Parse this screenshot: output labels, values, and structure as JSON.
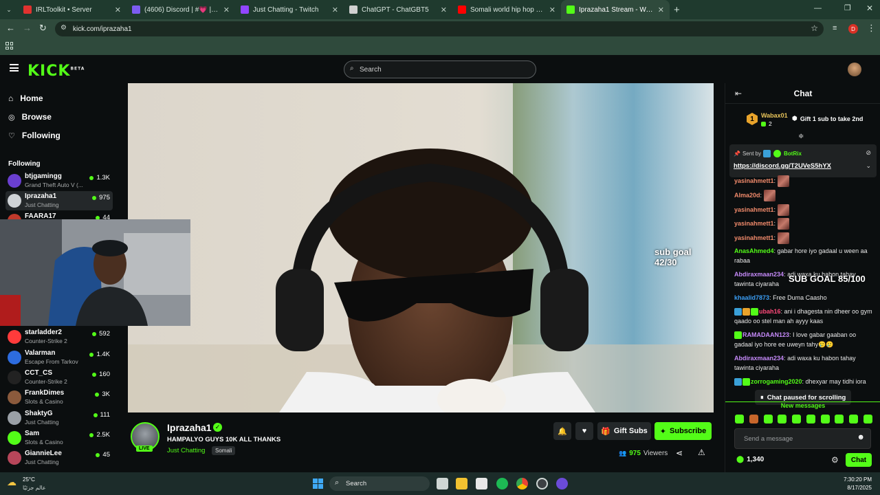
{
  "browser": {
    "tabs": [
      {
        "title": "IRLToolkit • Server",
        "color": "#e0322f"
      },
      {
        "title": "(4606) Discord | #💗 | STEAR",
        "color": "#7c5cf0"
      },
      {
        "title": "Just Chatting - Twitch",
        "color": "#9146ff"
      },
      {
        "title": "ChatGPT - ChatGBT5",
        "color": "#d0d0d0"
      },
      {
        "title": "Somali world hip hop Tonight",
        "color": "#ff0000"
      },
      {
        "title": "Iprazaha1 Stream - Watch Live",
        "color": "#53fc18"
      }
    ],
    "url": "kick.com/iprazaha1",
    "profile_letter": "D"
  },
  "header": {
    "logo": "KICK",
    "logo_sup": "BETA",
    "search_placeholder": "Search"
  },
  "sidebar": {
    "nav": [
      {
        "label": "Home"
      },
      {
        "label": "Browse"
      },
      {
        "label": "Following"
      }
    ],
    "following_title": "Following",
    "channels": [
      {
        "name": "btjgamingg",
        "game": "Grand Theft Auto V (...",
        "viewers": "1.3K",
        "color": "#6a3fd0"
      },
      {
        "name": "Iprazaha1",
        "game": "Just Chatting",
        "viewers": "975",
        "color": "#cfd3d6"
      },
      {
        "name": "FAARA17",
        "game": "",
        "viewers": "44",
        "color": "#c0392b"
      },
      {
        "name": "starladder2",
        "game": "Counter-Strike 2",
        "viewers": "592",
        "color": "#ff3b3b"
      },
      {
        "name": "Valarman",
        "game": "Escape From Tarkov",
        "viewers": "1.4K",
        "color": "#2d6cdf"
      },
      {
        "name": "CCT_CS",
        "game": "Counter-Strike 2",
        "viewers": "160",
        "color": "#222"
      },
      {
        "name": "FrankDimes",
        "game": "Slots & Casino",
        "viewers": "3K",
        "color": "#8b5a3c"
      },
      {
        "name": "ShaktyG",
        "game": "Just Chatting",
        "viewers": "111",
        "color": "#9aa0a6"
      },
      {
        "name": "Sam",
        "game": "Slots & Casino",
        "viewers": "2.5K",
        "color": "#53fc18"
      },
      {
        "name": "GiannieLee",
        "game": "Just Chatting",
        "viewers": "45",
        "color": "#b7465a"
      }
    ]
  },
  "video": {
    "overlay_sub_goal_small": "sub goal 42/30",
    "overlay_sub_goal_big": "SUB GOAL 85/100"
  },
  "channel": {
    "name": "Iprazaha1",
    "title": "HAMPALYO GUYS 10K ALL THANKS",
    "category": "Just Chatting",
    "tag": "Somali",
    "live_label": "LIVE",
    "gift_label": "Gift Subs",
    "subscribe_label": "Subscribe",
    "viewers": "975",
    "viewers_label": "Viewers"
  },
  "chat": {
    "title": "Chat",
    "leader": {
      "rank": "1",
      "name": "Wabax01",
      "count": "2",
      "action": "Gift 1 sub to take 2nd"
    },
    "pinned": {
      "sent_by_label": "Sent by",
      "sender": "BotRix",
      "link": "https://discord.gg/T2UVeS5hYX"
    },
    "messages": [
      {
        "user": "yasinahmett1",
        "text": "",
        "color": "#f08a6b",
        "emote": true
      },
      {
        "user": "Alma20d",
        "text": "",
        "color": "#f08a6b",
        "emote": true
      },
      {
        "user": "yasinahmett1",
        "text": "",
        "color": "#f08a6b",
        "emote": true
      },
      {
        "user": "yasinahmett1",
        "text": "",
        "color": "#f08a6b",
        "emote": true
      },
      {
        "user": "yasinahmett1",
        "text": "",
        "color": "#f08a6b",
        "emote": true
      },
      {
        "user": "AnasAhmed4",
        "text": "gabar hore iyo gadaal u ween aa rabaa",
        "color": "#53fc18",
        "emote": false
      },
      {
        "user": "Abdiraxmaan234",
        "text": "adi waxa ku habon tahay tawinta ciyaraha",
        "color": "#c58af9",
        "emote": false
      },
      {
        "user": "khaalid7873",
        "text": "Free Duma Caasho",
        "color": "#3b9ef5",
        "emote": false
      },
      {
        "user": "ubah16",
        "text": "ani i dhagesta nin dheer oo gym qaado oo stel man ah ayyy kaas",
        "color": "#ff4a7a",
        "emote": false
      },
      {
        "user": "RAMADAAN123",
        "text": "I love gabar gaaban oo gadaal iyo hore ee uweyn tahy🥲🥲",
        "color": "#c58af9",
        "emote": false
      },
      {
        "user": "Abdiraxmaan234",
        "text": "adi waxa ku habon tahay tawinta ciyaraha",
        "color": "#c58af9",
        "emote": false
      },
      {
        "user": "zorrogaming2020",
        "text": "dhexyar may tidhi iora",
        "color": "#53fc18",
        "emote": false
      }
    ],
    "paused_label": "Chat paused for scrolling",
    "new_messages_label": "New messages",
    "input_placeholder": "Send a message",
    "points": "1,340",
    "send_label": "Chat"
  },
  "taskbar": {
    "weather_temp": "25°C",
    "weather_desc": "عالم جزئيًا",
    "search_label": "Search",
    "time": "7:30:20 PM",
    "date": "8/17/2025"
  }
}
